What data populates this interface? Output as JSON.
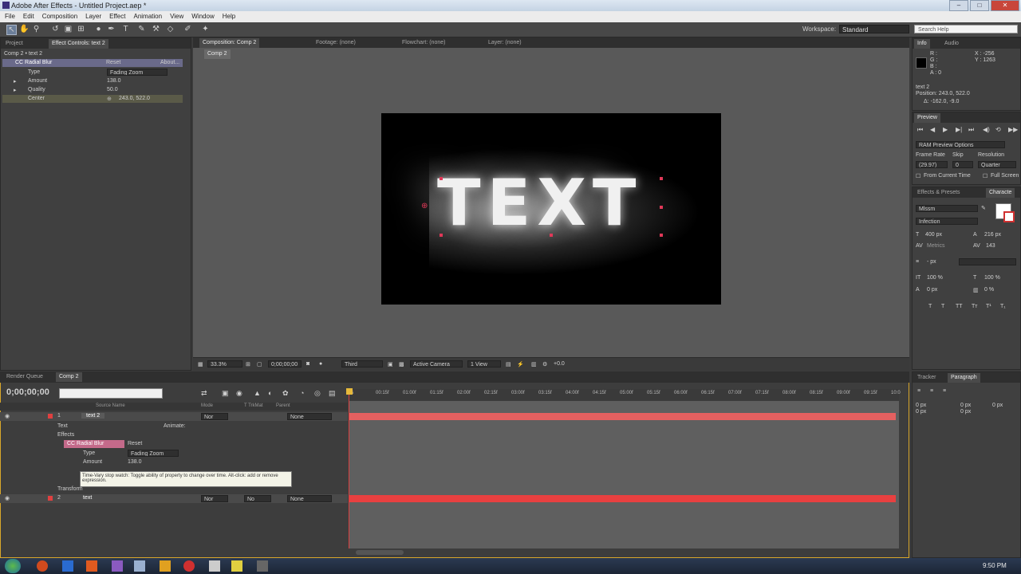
{
  "window": {
    "title": "Adobe After Effects - Untitled Project.aep *"
  },
  "menu": [
    "File",
    "Edit",
    "Composition",
    "Layer",
    "Effect",
    "Animation",
    "View",
    "Window",
    "Help"
  ],
  "workspace": {
    "label": "Workspace:",
    "value": "Standard"
  },
  "search_help": {
    "placeholder": "Search Help"
  },
  "left_panel": {
    "tabs": [
      "Project",
      "Effect Controls: text 2"
    ],
    "breadcrumb": "Comp 2 • text 2",
    "effect": {
      "name": "CC Radial Blur",
      "reset": "Reset",
      "about": "About..."
    },
    "props": [
      {
        "label": "Type",
        "value": "Fading Zoom"
      },
      {
        "label": "Amount",
        "value": "138.0"
      },
      {
        "label": "Quality",
        "value": "50.0"
      },
      {
        "label": "Center",
        "value": "243.0, 522.0"
      }
    ]
  },
  "viewer": {
    "tabs": [
      "Composition: Comp 2",
      "Footage: (none)",
      "Flowchart: (none)",
      "Layer: (none)"
    ],
    "subtab": "Comp 2",
    "canvas_text": "TEXT",
    "bottom": {
      "zoom": "33.3%",
      "timecode": "0;00;00;00",
      "resolution": "Third",
      "camera": "Active Camera",
      "view": "1 View",
      "exposure": "+0.0"
    }
  },
  "info_panel": {
    "tabs": [
      "Info",
      "Audio"
    ],
    "rgb": [
      "R :",
      "G :",
      "B :",
      "A : 0"
    ],
    "coords": [
      "X : -256",
      "Y : 1263"
    ],
    "layer": "text 2",
    "position": "Position: 243.0, 522.0",
    "delta": "Δ: -162.0, -9.0"
  },
  "preview_panel": {
    "tab": "Preview",
    "ram": "RAM Preview Options",
    "frame_rate_label": "Frame Rate",
    "skip_label": "Skip",
    "resolution_label": "Resolution",
    "frame_rate": "(29.97)",
    "skip": "0",
    "resolution": "Quarter",
    "from_current": "From Current Time",
    "full_screen": "Full Screen"
  },
  "character_panel": {
    "tabs": [
      "Effects & Presets",
      "Characte"
    ],
    "font": "Mlssm",
    "style": "Infection",
    "size": "400 px",
    "leading": "216 px",
    "tracking_metric": "Metrics",
    "tracking": "143",
    "stroke_unit": "- px",
    "vscale": "100 %",
    "hscale": "100 %",
    "baseline": "0 px",
    "tsume": "0 %"
  },
  "paragraph_panel": {
    "tabs": [
      "Tracker",
      "Paragraph"
    ],
    "values": [
      "0 px",
      "0 px",
      "0 px",
      "0 px",
      "0 px"
    ]
  },
  "timeline": {
    "tabs": [
      "Render Queue",
      "Comp 2"
    ],
    "timecode": "0;00;00;00",
    "headers": [
      "Source Name",
      "Mode",
      "T TrkMat",
      "Parent"
    ],
    "ticks": [
      "0s",
      "00:15f",
      "01:00f",
      "01:15f",
      "02:00f",
      "02:15f",
      "03:00f",
      "03:15f",
      "04:00f",
      "04:15f",
      "05:00f",
      "05:15f",
      "06:00f",
      "06:15f",
      "07:00f",
      "07:15f",
      "08:00f",
      "08:15f",
      "09:00f",
      "09:15f",
      "10:0"
    ],
    "layer1": {
      "num": "1",
      "name": "text 2",
      "mode": "Nor",
      "parent": "None"
    },
    "rows": [
      "Text",
      "Animate:",
      "Effects",
      "CC Radial Blur",
      "Reset",
      "Type",
      "Fading Zoom",
      "Amount",
      "138.0",
      "Transform"
    ],
    "tooltip": "Time-Vary stop watch: Toggle ability of property to change over time. Alt-click: add or remove expression.",
    "layer2": {
      "num": "2",
      "name": "text",
      "mode": "Nor",
      "trkmat": "No",
      "parent": "None"
    }
  },
  "taskbar": {
    "clock": "9:50 PM"
  },
  "colors": {
    "accent": "#e6b93b",
    "layer1": "#e46060",
    "layer2": "#e84040"
  }
}
